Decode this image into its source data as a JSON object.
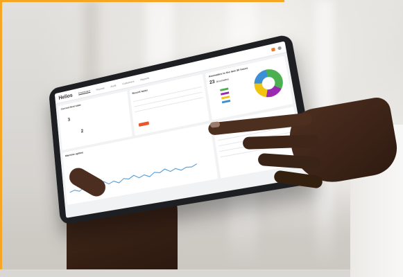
{
  "scene": {
    "description_free": true,
    "accent_color": "#f5a623"
  },
  "tablet": {
    "app_logo": "Helios",
    "tabs": [
      "Dashboard",
      "Reports",
      "Audit",
      "Customers",
      "Reports"
    ],
    "active_tab_index": 0,
    "cards": {
      "first_title": "Current fleet state",
      "first_value_a": "3",
      "first_value_b": "2",
      "second_title": "Recent tasks",
      "third_title": "Anomalies in the last 30 hours",
      "third_value": "23",
      "third_value_label": "Anomalies",
      "bottom_left_title": "Machine uptime",
      "bottom_right_title": "Recent pending tasks"
    },
    "donut_colors": [
      "#4caf50",
      "#9c27b0",
      "#f1c40f",
      "#3b8fd4"
    ]
  }
}
